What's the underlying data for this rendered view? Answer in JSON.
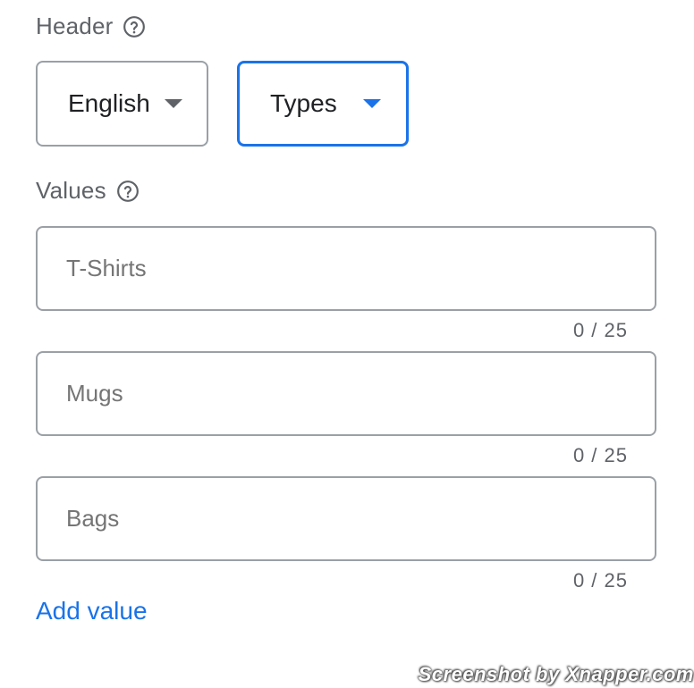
{
  "header": {
    "label": "Header",
    "help_icon": "help-circle-icon"
  },
  "dropdowns": {
    "language": {
      "value": "English"
    },
    "type": {
      "value": "Types"
    }
  },
  "values": {
    "label": "Values",
    "help_icon": "help-circle-icon",
    "fields": [
      {
        "placeholder": "T-Shirts",
        "counter": "0 / 25"
      },
      {
        "placeholder": "Mugs",
        "counter": "0 / 25"
      },
      {
        "placeholder": "Bags",
        "counter": "0 / 25"
      }
    ]
  },
  "add_value_label": "Add value",
  "watermark": "Screenshot by Xnapper.com",
  "colors": {
    "accent": "#1a73e8",
    "border": "#9aa0a6",
    "label_text": "#5f6368"
  }
}
